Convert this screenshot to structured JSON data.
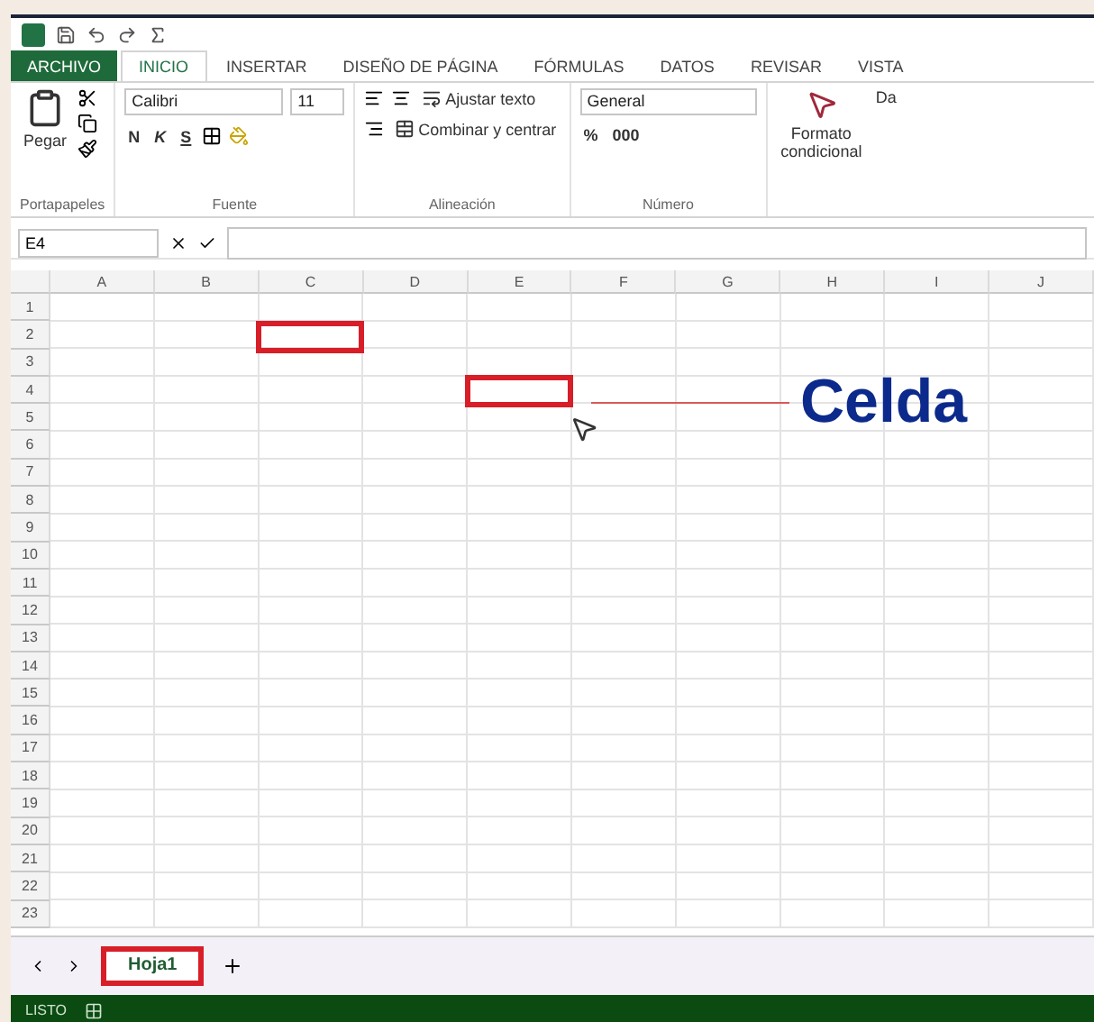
{
  "ribbon_tabs": [
    {
      "label": "ARCHIVO",
      "kind": "file",
      "selected": false
    },
    {
      "label": "INICIO",
      "kind": "tab",
      "selected": true
    },
    {
      "label": "INSERTAR",
      "kind": "tab",
      "selected": false
    },
    {
      "label": "DISEÑO DE PÁGINA",
      "kind": "tab",
      "selected": false
    },
    {
      "label": "FÓRMULAS",
      "kind": "tab",
      "selected": false
    },
    {
      "label": "DATOS",
      "kind": "tab",
      "selected": false
    },
    {
      "label": "REVISAR",
      "kind": "tab",
      "selected": false
    },
    {
      "label": "VISTA",
      "kind": "tab",
      "selected": false
    }
  ],
  "ribbon": {
    "paste_label": "Pegar",
    "font_name": "Calibri",
    "font_size": "11",
    "bold": "N",
    "italic": "K",
    "underline": "S",
    "wrap_text": "Ajustar texto",
    "merge": "Combinar y centrar",
    "number_format": "General",
    "percent": "%",
    "thousands": "000",
    "conditional_format": "Formato condicional",
    "styles_cut": "Da",
    "groups": [
      "Portapapeles",
      "Fuente",
      "Alineación",
      "Número"
    ]
  },
  "name_box": "E4",
  "columns": [
    "A",
    "B",
    "C",
    "D",
    "E",
    "F",
    "G",
    "H",
    "I",
    "J"
  ],
  "rows": [
    {
      "label": "1"
    },
    {
      "label": "2"
    },
    {
      "label": "3"
    },
    {
      "label": "4"
    },
    {
      "label": "5"
    },
    {
      "label": "6"
    },
    {
      "label": "7"
    },
    {
      "label": "8"
    },
    {
      "label": "9"
    },
    {
      "label": "10"
    },
    {
      "label": "11"
    },
    {
      "label": "12"
    },
    {
      "label": "13"
    },
    {
      "label": "14"
    },
    {
      "label": "15"
    },
    {
      "label": "16"
    },
    {
      "label": "17"
    },
    {
      "label": "18"
    },
    {
      "label": "19"
    },
    {
      "label": "20"
    },
    {
      "label": "21"
    },
    {
      "label": "22"
    },
    {
      "label": "23"
    }
  ],
  "annotations": [
    {
      "kind": "box"
    },
    {
      "kind": "box"
    },
    {
      "kind": "callout",
      "label": "Celda"
    }
  ],
  "sheets": [
    {
      "label": "Hoja1",
      "selected": true
    }
  ],
  "status_bar": {
    "text": "LISTO"
  }
}
